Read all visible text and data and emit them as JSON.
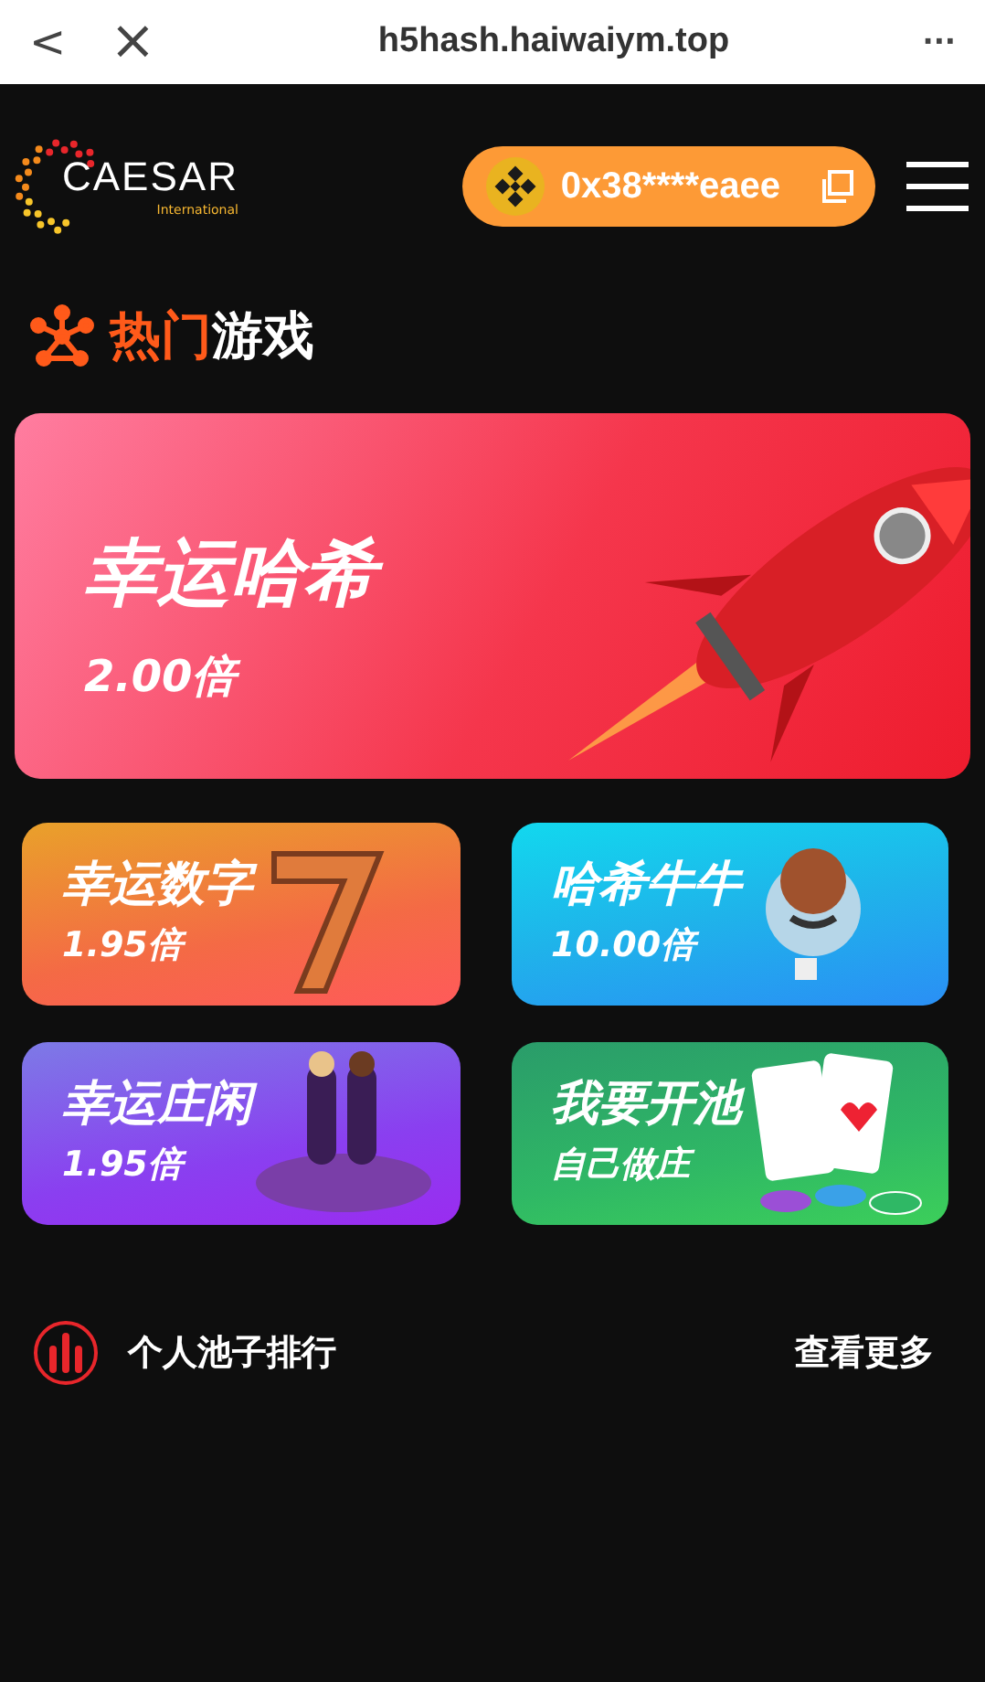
{
  "browser_bar": {
    "url": "h5hash.haiwaiym.top",
    "back": "<",
    "close": "×",
    "more": "···"
  },
  "header": {
    "logo_text": "CAESAR",
    "logo_sub": "International",
    "wallet": "0x38****eaee"
  },
  "section": {
    "title_accent": "热门",
    "title_rest": "游戏"
  },
  "featured": {
    "title": "幸运哈希",
    "odds": "2.00倍",
    "kind": "rocket"
  },
  "games": [
    {
      "title": "幸运数字",
      "odds": "1.95倍",
      "kind": "seven"
    },
    {
      "title": "哈希牛牛",
      "odds": "10.00倍",
      "kind": "mascot"
    },
    {
      "title": "幸运庄闲",
      "odds": "1.95倍",
      "kind": "table"
    },
    {
      "title": "我要开池",
      "odds": "自己做庄",
      "kind": "cards"
    }
  ],
  "ranking": {
    "title": "个人池子排行",
    "more": "查看更多"
  }
}
